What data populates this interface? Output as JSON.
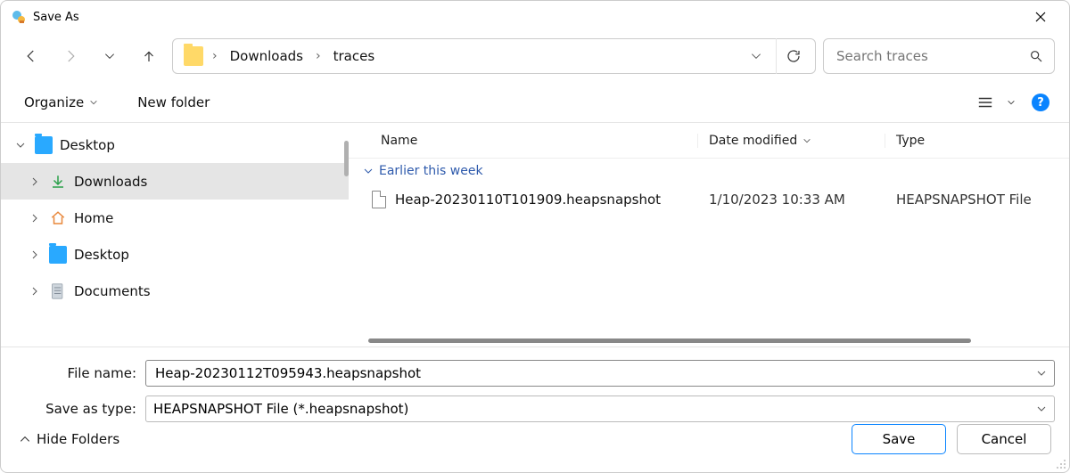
{
  "window": {
    "title": "Save As"
  },
  "nav": {
    "breadcrumb": [
      "Downloads",
      "traces"
    ],
    "search_placeholder": "Search traces"
  },
  "toolbar": {
    "organize": "Organize",
    "new_folder": "New folder"
  },
  "tree": {
    "items": [
      {
        "label": "Desktop",
        "icon": "desktop-blue",
        "level": 1,
        "expanded": true,
        "selected": false
      },
      {
        "label": "Downloads",
        "icon": "download-arrow",
        "level": 2,
        "expanded": false,
        "selected": true
      },
      {
        "label": "Home",
        "icon": "home",
        "level": 2,
        "expanded": false,
        "selected": false
      },
      {
        "label": "Desktop",
        "icon": "desktop-blue",
        "level": 2,
        "expanded": false,
        "selected": false
      },
      {
        "label": "Documents",
        "icon": "document",
        "level": 2,
        "expanded": false,
        "selected": false
      }
    ]
  },
  "filelist": {
    "columns": {
      "name": "Name",
      "date": "Date modified",
      "type": "Type"
    },
    "group_label": "Earlier this week",
    "rows": [
      {
        "name": "Heap-20230110T101909.heapsnapshot",
        "date": "1/10/2023 10:33 AM",
        "type": "HEAPSNAPSHOT File"
      }
    ]
  },
  "form": {
    "filename_label": "File name:",
    "filename_value": "Heap-20230112T095943.heapsnapshot",
    "saveastype_label": "Save as type:",
    "saveastype_value": "HEAPSNAPSHOT File (*.heapsnapshot)"
  },
  "footer": {
    "hide_folders": "Hide Folders",
    "save": "Save",
    "cancel": "Cancel"
  }
}
